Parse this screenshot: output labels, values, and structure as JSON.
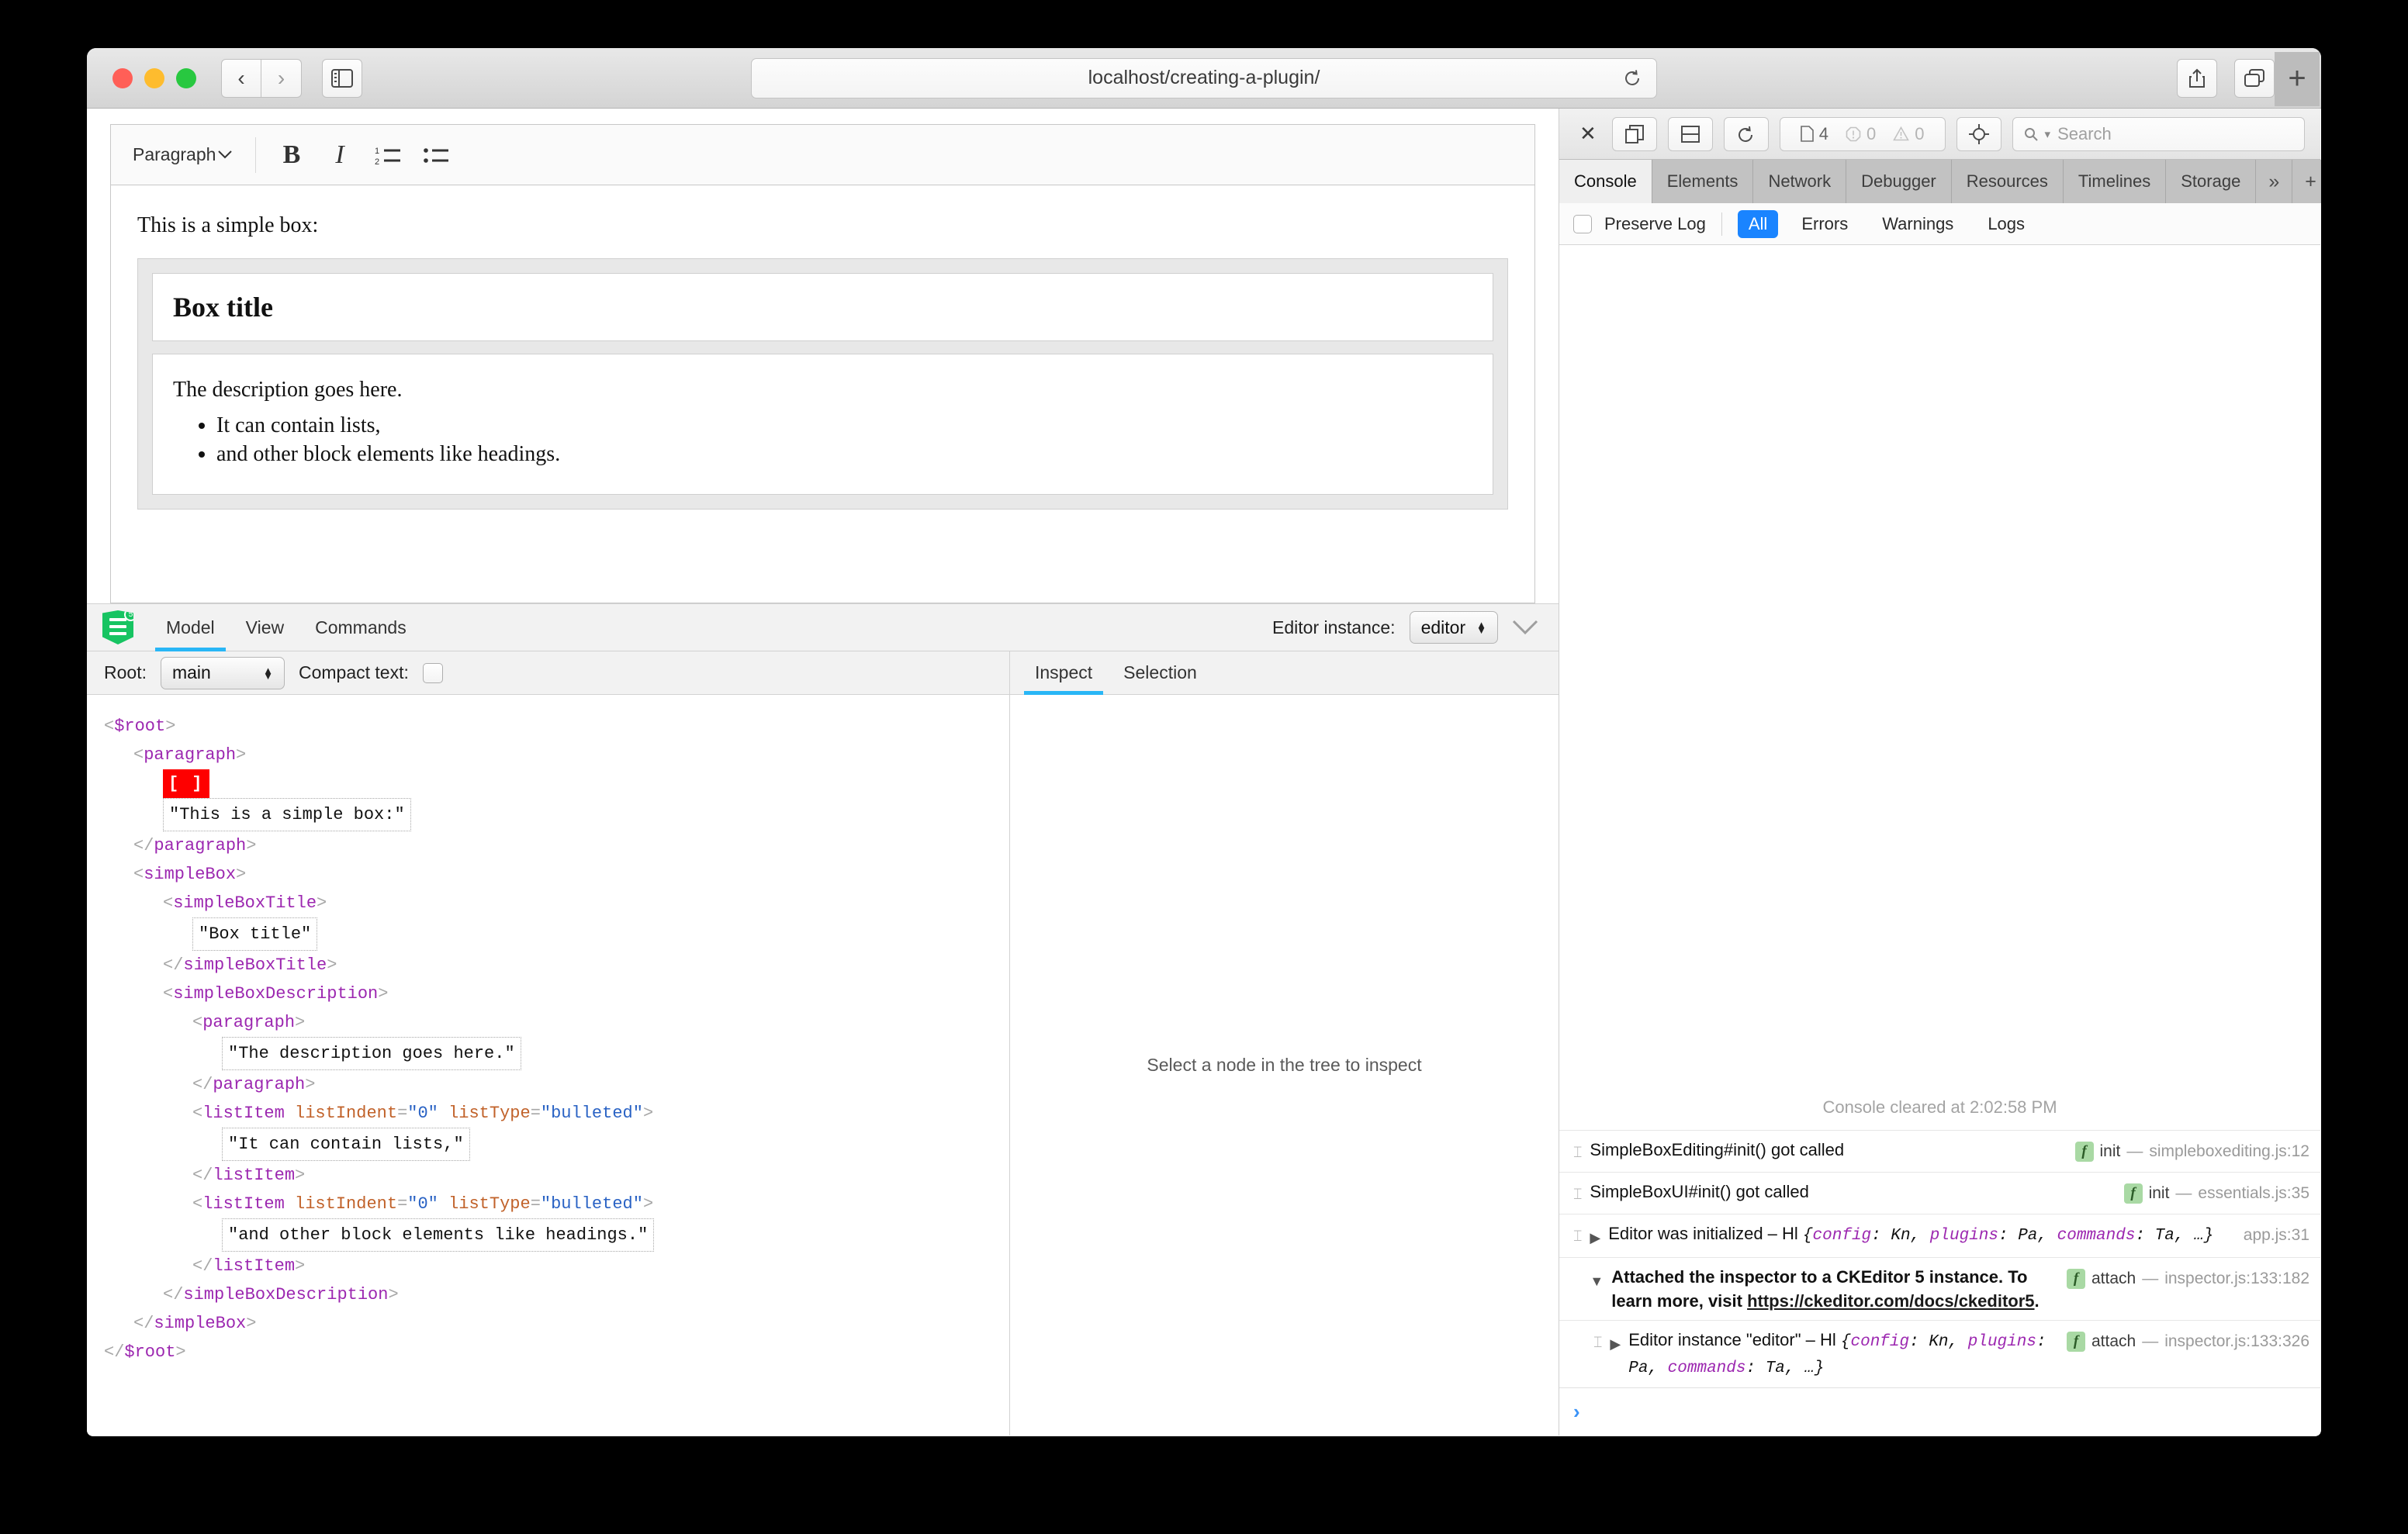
{
  "browser": {
    "url": "localhost/creating-a-plugin/",
    "back_label": "‹",
    "forward_label": "›",
    "sidebar_icon": "sidebar-icon",
    "reload_icon": "reload-icon",
    "share_icon": "share-icon",
    "tabs_icon": "tab-overview-icon",
    "new_tab_label": "+"
  },
  "editor": {
    "toolbar": {
      "paragraph_label": "Paragraph",
      "dropdown_caret": "⌄",
      "bold_label": "B",
      "italic_label": "I",
      "numbered_list_name": "numbered-list-icon",
      "bulleted_list_name": "bulleted-list-icon"
    },
    "content": {
      "intro": "This is a simple box:",
      "box_title": "Box title",
      "box_description": "The description goes here.",
      "list_items": [
        "It can contain lists,",
        "and other block elements like headings."
      ]
    }
  },
  "ck_inspector": {
    "logo_badge": "5",
    "tabs": [
      {
        "label": "Model",
        "active": true
      },
      {
        "label": "View",
        "active": false
      },
      {
        "label": "Commands",
        "active": false
      }
    ],
    "editor_instance_label": "Editor instance:",
    "editor_instance_value": "editor",
    "collapse_icon": "chevron-down-icon",
    "root_label": "Root:",
    "root_value": "main",
    "compact_text_label": "Compact text:",
    "compact_text_checked": false,
    "side_tabs": [
      {
        "label": "Inspect",
        "active": true
      },
      {
        "label": "Selection",
        "active": false
      }
    ],
    "inspect_placeholder": "Select a node in the tree to inspect",
    "tree": [
      {
        "indent": 0,
        "type": "open",
        "tag": "$root"
      },
      {
        "indent": 1,
        "type": "open",
        "tag": "paragraph"
      },
      {
        "indent": 2,
        "type": "selection",
        "text": "[ ]"
      },
      {
        "indent": 2,
        "type": "text",
        "text": "\"This is a simple box:\""
      },
      {
        "indent": 1,
        "type": "close",
        "tag": "paragraph"
      },
      {
        "indent": 1,
        "type": "open",
        "tag": "simpleBox"
      },
      {
        "indent": 2,
        "type": "open",
        "tag": "simpleBoxTitle"
      },
      {
        "indent": 3,
        "type": "text",
        "text": "\"Box title\""
      },
      {
        "indent": 2,
        "type": "close",
        "tag": "simpleBoxTitle"
      },
      {
        "indent": 2,
        "type": "open",
        "tag": "simpleBoxDescription"
      },
      {
        "indent": 3,
        "type": "open",
        "tag": "paragraph"
      },
      {
        "indent": 4,
        "type": "text",
        "text": "\"The description goes here.\""
      },
      {
        "indent": 3,
        "type": "close",
        "tag": "paragraph"
      },
      {
        "indent": 3,
        "type": "open",
        "tag": "listItem",
        "attrs": [
          {
            "name": "listIndent",
            "value": "\"0\""
          },
          {
            "name": "listType",
            "value": "\"bulleted\""
          }
        ]
      },
      {
        "indent": 4,
        "type": "text",
        "text": "\"It can contain lists,\""
      },
      {
        "indent": 3,
        "type": "close",
        "tag": "listItem"
      },
      {
        "indent": 3,
        "type": "open",
        "tag": "listItem",
        "attrs": [
          {
            "name": "listIndent",
            "value": "\"0\""
          },
          {
            "name": "listType",
            "value": "\"bulleted\""
          }
        ]
      },
      {
        "indent": 4,
        "type": "text",
        "text": "\"and other block elements like headings.\""
      },
      {
        "indent": 3,
        "type": "close",
        "tag": "listItem"
      },
      {
        "indent": 2,
        "type": "close",
        "tag": "simpleBoxDescription"
      },
      {
        "indent": 1,
        "type": "close",
        "tag": "simpleBox"
      },
      {
        "indent": 0,
        "type": "close",
        "tag": "$root"
      }
    ]
  },
  "web_inspector": {
    "toolbar": {
      "close_label": "✕",
      "dock_right_icon": "dock-right-icon",
      "dock_bottom_icon": "dock-bottom-icon",
      "reload_icon": "reload-icon",
      "resource_count": "4",
      "error_count": "0",
      "warning_count": "0",
      "inspect_element_icon": "crosshair-icon",
      "search_placeholder": "Search",
      "search_prefix": "Q"
    },
    "tabs": [
      {
        "label": "Console",
        "active": true
      },
      {
        "label": "Elements",
        "active": false
      },
      {
        "label": "Network",
        "active": false
      },
      {
        "label": "Debugger",
        "active": false
      },
      {
        "label": "Resources",
        "active": false
      },
      {
        "label": "Timelines",
        "active": false
      },
      {
        "label": "Storage",
        "active": false
      }
    ],
    "tab_overflow": "»",
    "tab_add": "+",
    "tab_settings_icon": "gear-icon",
    "filter": {
      "preserve_log_label": "Preserve Log",
      "preserve_log_checked": false,
      "levels": [
        {
          "label": "All",
          "active": true
        },
        {
          "label": "Errors",
          "active": false
        },
        {
          "label": "Warnings",
          "active": false
        },
        {
          "label": "Logs",
          "active": false
        }
      ]
    },
    "console": {
      "cleared_notice": "Console cleared at 2:02:58 PM",
      "messages": [
        {
          "text": "SimpleBoxEditing#init() got called",
          "bold": false,
          "disclosure": false,
          "src_fn": "init",
          "src_loc": "simpleboxediting.js:12"
        },
        {
          "text": "SimpleBoxUI#init() got called",
          "bold": false,
          "disclosure": false,
          "src_fn": "init",
          "src_loc": "essentials.js:35"
        },
        {
          "text": "Editor was initialized – Hl ",
          "object": "{config: Kn, plugins: Pa, commands: Ta, …}",
          "object_keys": [
            "config",
            "plugins",
            "commands"
          ],
          "object_vals": [
            "Kn",
            "Pa",
            "Ta"
          ],
          "bold": false,
          "disclosure": true,
          "disclosure_open": false,
          "src_fn": "",
          "src_loc": "app.js:31"
        },
        {
          "text": "Attached the inspector to a CKEditor 5 instance. To learn more, visit ",
          "link": "https://ckeditor.com/docs/ckeditor5",
          "text_after": ".",
          "bold": true,
          "disclosure": true,
          "disclosure_open": true,
          "src_fn": "attach",
          "src_loc": "inspector.js:133:182"
        },
        {
          "text": "Editor instance \"editor\" – Hl ",
          "object": "{config: Kn, plugins: Pa, commands: Ta, …}",
          "object_keys": [
            "config",
            "plugins",
            "commands"
          ],
          "object_vals": [
            "Kn",
            "Pa",
            "Ta"
          ],
          "bold": false,
          "indented": true,
          "disclosure": true,
          "disclosure_open": false,
          "src_fn": "attach",
          "src_loc": "inspector.js:133:326"
        }
      ],
      "prompt_caret": "›"
    }
  },
  "colors": {
    "accent_blue": "#29b6f6",
    "filter_active": "#1a84ff",
    "selection_red": "#fe0000",
    "ck_green": "#17c462",
    "tag_purple": "#9c27b0",
    "attr_orange": "#c1622a",
    "value_blue": "#2962c4"
  }
}
